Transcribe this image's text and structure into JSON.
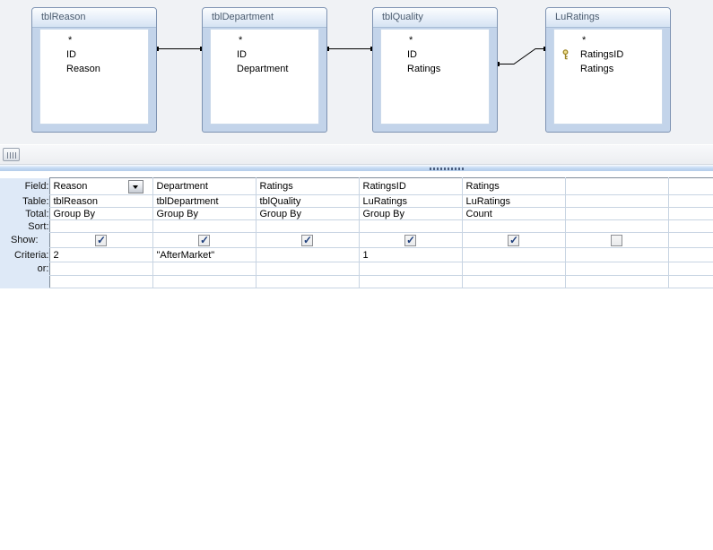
{
  "app": {
    "view": "query-design"
  },
  "diagram": {
    "tables": [
      {
        "name": "tblReason",
        "fields": [
          "*",
          "ID",
          "Reason"
        ]
      },
      {
        "name": "tblDepartment",
        "fields": [
          "*",
          "ID",
          "Department"
        ]
      },
      {
        "name": "tblQuality",
        "fields": [
          "*",
          "ID",
          "Ratings"
        ]
      },
      {
        "name": "LuRatings",
        "fields": [
          "*",
          "RatingsID",
          "Ratings"
        ],
        "key_field": "RatingsID"
      }
    ]
  },
  "grid": {
    "row_labels": [
      "Field:",
      "Table:",
      "Total:",
      "Sort:",
      "Show:",
      "Criteria:",
      "or:"
    ],
    "columns": [
      {
        "field": "Reason",
        "table": "tblReason",
        "total": "Group By",
        "sort": "",
        "show": true,
        "criteria": "2",
        "or": ""
      },
      {
        "field": "Department",
        "table": "tblDepartment",
        "total": "Group By",
        "sort": "",
        "show": true,
        "criteria": "\"AfterMarket\"",
        "or": ""
      },
      {
        "field": "Ratings",
        "table": "tblQuality",
        "total": "Group By",
        "sort": "",
        "show": true,
        "criteria": "",
        "or": ""
      },
      {
        "field": "RatingsID",
        "table": "LuRatings",
        "total": "Group By",
        "sort": "",
        "show": true,
        "criteria": "1",
        "or": ""
      },
      {
        "field": "Ratings",
        "table": "LuRatings",
        "total": "Count",
        "sort": "",
        "show": true,
        "criteria": "",
        "or": ""
      },
      {
        "field": "",
        "table": "",
        "total": "",
        "sort": "",
        "show": false,
        "criteria": "",
        "or": ""
      },
      {
        "field": "",
        "table": "",
        "total": "",
        "sort": "",
        "criteria": "",
        "or": ""
      }
    ]
  },
  "colors": {
    "pane_bg": "#F0F2F5",
    "table_frame": "#C3D4EA",
    "table_border": "#7E93B2",
    "header_text": "#4A5B6E",
    "label_bg": "#DEE9F7",
    "grid_line": "#C8D4E2",
    "grid_outer": "#7F8B99",
    "check": "#1F3F7C",
    "key_gold": "#E8D06A",
    "splitter": "#B4CDEA"
  }
}
